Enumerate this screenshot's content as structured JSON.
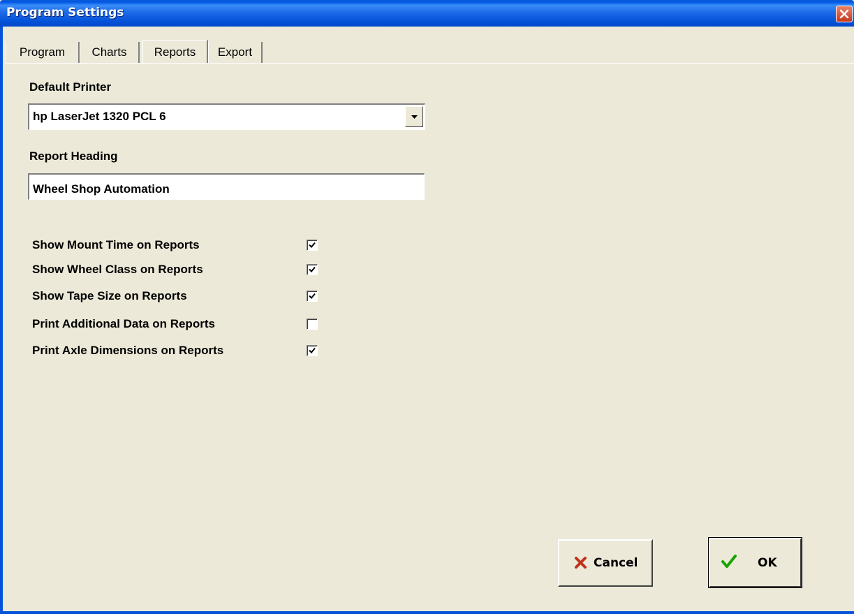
{
  "window": {
    "title": "Program Settings"
  },
  "tabs": [
    {
      "label": "Program"
    },
    {
      "label": "Charts"
    },
    {
      "label": "Reports",
      "active": true
    },
    {
      "label": "Export"
    }
  ],
  "printer": {
    "label": "Default Printer",
    "value": "hp LaserJet 1320 PCL 6"
  },
  "heading": {
    "label": "Report Heading",
    "value": "Wheel Shop Automation"
  },
  "options": [
    {
      "label": "Show Mount Time on Reports",
      "checked": true
    },
    {
      "label": "Show Wheel Class on Reports",
      "checked": true
    },
    {
      "label": "Show Tape Size on Reports",
      "checked": true
    },
    {
      "label": "Print Additional Data on Reports",
      "checked": false
    },
    {
      "label": "Print Axle Dimensions on Reports",
      "checked": true
    }
  ],
  "buttons": {
    "cancel": "Cancel",
    "ok": "OK"
  },
  "colors": {
    "titlebar": "#0553d9",
    "face": "#ece9d8",
    "cancel_icon": "#c0321c",
    "ok_icon": "#17a300"
  }
}
